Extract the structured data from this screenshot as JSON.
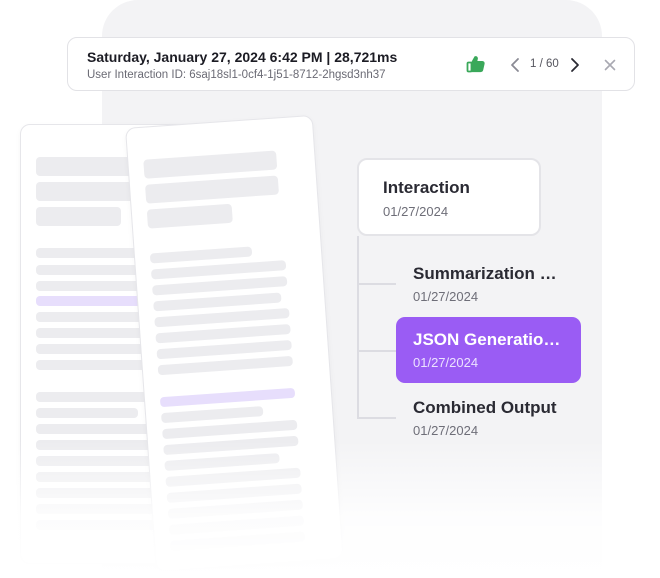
{
  "header": {
    "title": "Saturday, January 27, 2024 6:42 PM | 28,721ms",
    "subtitle": "User Interaction ID: 6saj18sl1-0cf4-1j51-8712-2hgsd3nh37",
    "pager": "1 / 60",
    "icons": {
      "feedback": "thumbs-up-icon",
      "prev": "chevron-left-icon",
      "next": "chevron-right-icon",
      "close": "close-icon"
    },
    "thumb_color": "#3aa85a"
  },
  "tree": {
    "root": {
      "title": "Interaction",
      "date": "01/27/2024"
    },
    "children": [
      {
        "title": "Summarization …",
        "date": "01/27/2024",
        "selected": false
      },
      {
        "title": "JSON Generatio…",
        "date": "01/27/2024",
        "selected": true
      },
      {
        "title": "Combined Output",
        "date": "01/27/2024",
        "selected": false
      }
    ]
  },
  "colors": {
    "accent": "#9a5cf4",
    "highlight": "#e7defc",
    "placeholder": "#ececef"
  }
}
